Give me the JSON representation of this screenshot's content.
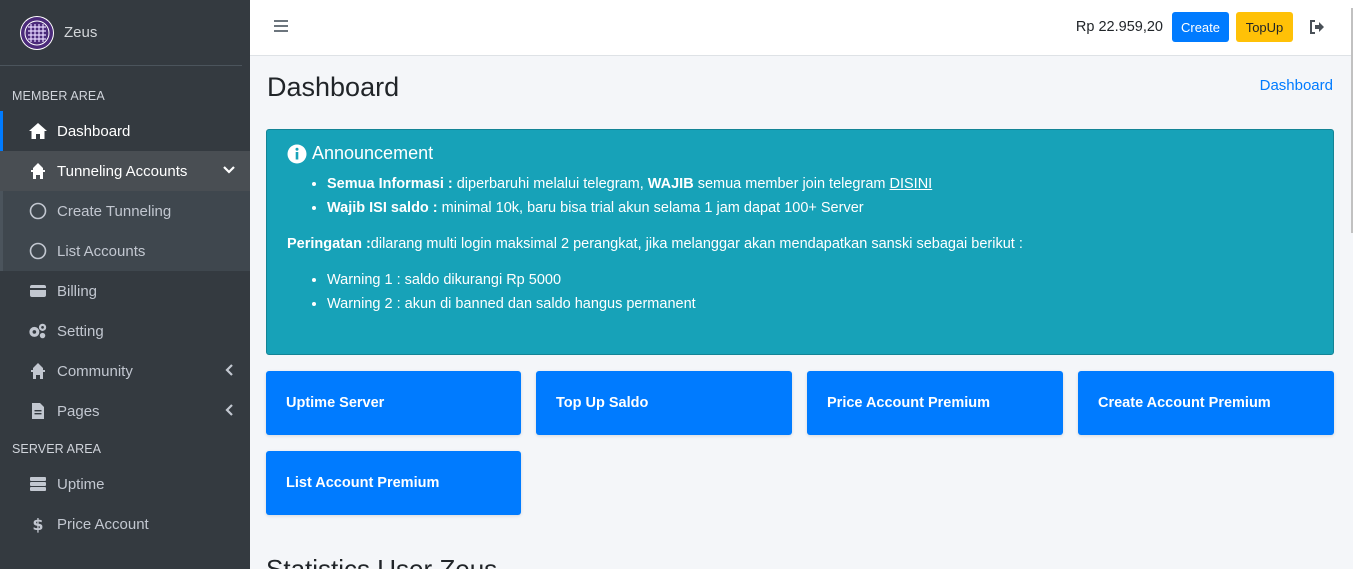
{
  "brand": {
    "name": "Zeus"
  },
  "sidebar": {
    "member_header": "MEMBER AREA",
    "server_header": "SERVER AREA",
    "items": [
      {
        "label": "Dashboard",
        "icon": "home-icon"
      },
      {
        "label": "Tunneling Accounts",
        "icon": "tunnel-icon"
      },
      {
        "label": "Create Tunneling",
        "icon": "circle-icon"
      },
      {
        "label": "List Accounts",
        "icon": "circle-icon"
      },
      {
        "label": "Billing",
        "icon": "wallet-icon"
      },
      {
        "label": "Setting",
        "icon": "gears-icon"
      },
      {
        "label": "Community",
        "icon": "community-icon"
      },
      {
        "label": "Pages",
        "icon": "file-icon"
      },
      {
        "label": "Uptime",
        "icon": "server-icon"
      },
      {
        "label": "Price Account",
        "icon": "dollar-icon"
      }
    ]
  },
  "topbar": {
    "balance": "Rp 22.959,20",
    "create_label": "Create",
    "topup_label": "TopUp"
  },
  "page": {
    "title": "Dashboard",
    "breadcrumb": "Dashboard"
  },
  "announcement": {
    "title": "Announcement",
    "item1_bold": "Semua Informasi :",
    "item1_text": " diperbaruhi melalui  telegram, ",
    "item1_bold2": "WAJIB",
    "item1_text2": " semua member join telegram ",
    "item1_link": "DISINI",
    "item2_bold": "Wajib ISI saldo :",
    "item2_text": " minimal 10k, baru bisa trial akun selama 1 jam dapat 100+ Server",
    "warning_bold": "Peringatan :",
    "warning_text": "dilarang multi login maksimal 2 perangkat, jika melanggar akan mendapatkan sanski sebagai berikut :",
    "warn1": "Warning 1 : saldo dikurangi Rp 5000",
    "warn2": "Warning 2 : akun di banned dan saldo hangus permanent"
  },
  "cards": {
    "c1": "Uptime Server",
    "c2": "Top Up Saldo",
    "c3": "Price Account Premium",
    "c4": "Create Account Premium",
    "c5": "List Account Premium"
  },
  "stats": {
    "title": "Statistics User Zeus"
  },
  "colors": {
    "primary": "#007bff",
    "info": "#17a2b8",
    "warning": "#ffc107",
    "sidebar": "#343a40"
  }
}
